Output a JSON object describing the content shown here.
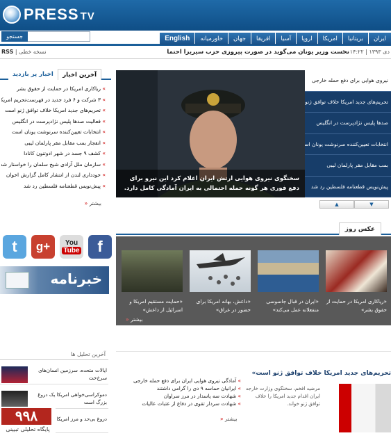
{
  "header": {
    "logo_text": "PRESS",
    "logo_suffix": "TV"
  },
  "search": {
    "button_label": "جستجو",
    "placeholder": ""
  },
  "nav": {
    "items": [
      "ایران",
      "بریتانیا",
      "امریکا",
      "اروپا",
      "آسیا",
      "افریقا",
      "جهان",
      "خاورمیانه",
      "English"
    ]
  },
  "ticker": {
    "rss_label": "RSS",
    "print_label": "نسخه خطی",
    "headline": "نخست وزیر یونان می‌گوید در صورت پیروزی حزب سیریزا احتما",
    "time": "۱۴:۲۲",
    "date": "۱۰ دی ۱۳۹۳"
  },
  "latest": {
    "tab_active": "آخرین اخبار",
    "tab_inactive": "اخبار پر بازدید",
    "items": [
      "ریاکاری امریکا در حمایت از حقوق بشر",
      "۳ شرکت و ۶ فرد جدید در فهرست‌تحریم امریکا",
      "تحریم‌های جدید امریکا خلاف توافق ژنو است",
      "فعالیت صدها پلیس نژادپرست در انگلیس",
      "انتخابات تعیین‌کننده سرنوشت یونان است",
      "انفجار بمب مقابل مقر پارلمان لیبی",
      "کشف ۹ جسد در شهر ادوتنون کانادا",
      "سازمان ملل آزادی شیخ سلمان را خواستار شد",
      "خودداری لندن از انتشار کامل گزارش اخوان",
      "پیش‌نویس قطعنامه فلسطین رد شد"
    ],
    "more": "بیشتر"
  },
  "slider": {
    "caption": "سخنگوی نیروی هوایی ارتش ایران اعلام کرد این نیرو برای دفع فوری هر گونه حمله احتمالی به ایران آمادگی کامل دارد.",
    "items": [
      "نیروی هوایی برای دفع حمله خارجی",
      "تحریم‌های جدید امریکا خلاف توافق ژنو است",
      "صدها پلیس نژادپرست در انگلیس",
      "انتخابات تعیین‌کننده سرنوشت یونان است",
      "بمب مقابل مقر پارلمان لیبی",
      "پیش‌نویس قطعنامه فلسطین رد شد"
    ]
  },
  "social": {
    "twitter_label": "t",
    "gplus_label": "g+",
    "youtube_top": "You",
    "youtube_bottom": "Tube",
    "facebook_label": "f"
  },
  "newsletter": {
    "label": "خبرنامه"
  },
  "photo_of_day": {
    "tab": "عکس روز",
    "captions": [
      "«ریاکاری امریکا در حمایت از حقوق بشر»",
      "«ایران در قبال جاسوسی منفعلانه عمل می‌کند»",
      "«داعش، بهانه امریکا برای حضور در عراق»",
      "«حمایت مستقیم امریکا و اسرائیل از داعش»"
    ],
    "more": "بیشتر"
  },
  "analysis": {
    "title": "آخرین تحلیل ها",
    "items": [
      "ایالات متحده، سرزمین انسان‌های سرخ‌خت",
      "دموکراسی‌خواهی امریکا یک دروغ بزرگ است",
      "دروغ بی‌حد و مرز امریکا درباره سیا"
    ]
  },
  "logo998": {
    "number": "۹۹۸",
    "text": "پایگاه تحلیلی تبیینی"
  },
  "bottom_main": {
    "headline": "تحریم‌های جدید امریکا خلاف توافق ژنو است»",
    "summary": "مرضیه افخم، سخنگوی وزارت خارجه ایران اقدام جدید امریکا را خلاف توافق ژنو خواند.",
    "list": [
      "آمادگی نیروی هوایی ایران برای دفع حمله خارجی",
      "ایرانیان حماسه ۹ دی را گرامی داشتند",
      "شهادت سه پاسدار در مرز سراوان",
      "شهادت سردار تقوی در دفاع از عتبات عالیات"
    ],
    "more": "بیشتر"
  },
  "colors": {
    "brand_blue": "#1b5f9a",
    "nav_blue": "#2e74b3",
    "accent_red": "#cc0000"
  }
}
